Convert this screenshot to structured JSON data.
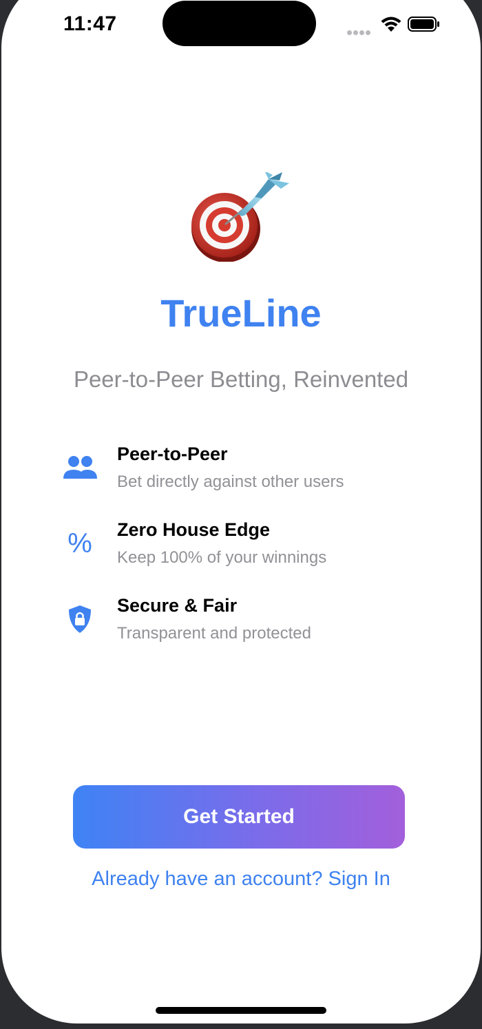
{
  "status_bar": {
    "time": "11:47",
    "icons": [
      "cellular-signal-icon",
      "wifi-icon",
      "battery-icon"
    ]
  },
  "app": {
    "logo_icon": "dart-target-icon",
    "title": "TrueLine",
    "tagline": "Peer-to-Peer Betting, Reinvented"
  },
  "features": [
    {
      "icon": "people-icon",
      "title": "Peer-to-Peer",
      "description": "Bet directly against other users"
    },
    {
      "icon": "percent-icon",
      "title": "Zero House Edge",
      "description": "Keep 100% of your winnings"
    },
    {
      "icon": "shield-lock-icon",
      "title": "Secure & Fair",
      "description": "Transparent and protected"
    }
  ],
  "actions": {
    "primary_label": "Get Started",
    "secondary_label": "Already have an account? Sign In"
  },
  "colors": {
    "accent": "#3f82f0",
    "gradient_start": "#3e83f5",
    "gradient_end": "#a35fdb",
    "muted_text": "#8c8c91"
  }
}
